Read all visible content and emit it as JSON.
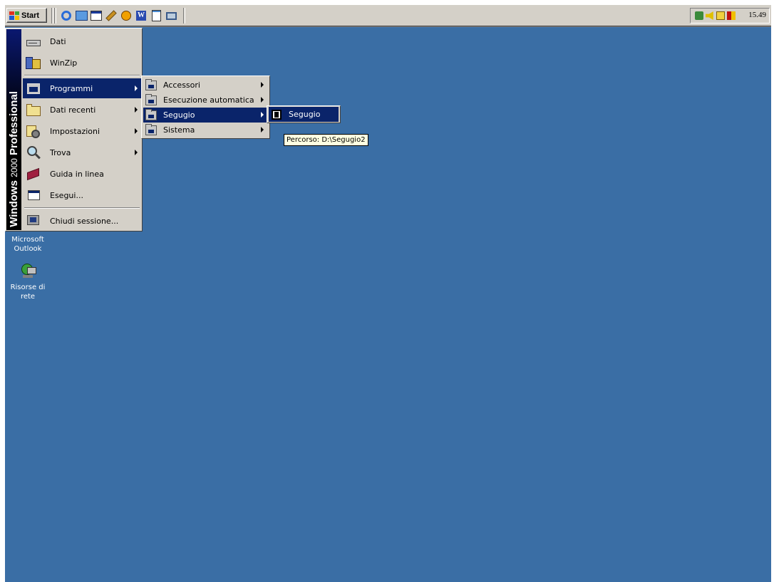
{
  "taskbar": {
    "start_label": "Start",
    "clock": "15.49",
    "quick_launch": [
      "ie-icon",
      "outlook-express-icon",
      "show-desktop-icon",
      "paint-icon",
      "media-player-icon",
      "word-icon",
      "notepad-icon",
      "computer-icon"
    ],
    "tray_icons": [
      "network-tray-icon",
      "volume-tray-icon",
      "printer-tray-icon",
      "antivirus-tray-icon"
    ]
  },
  "start_menu": {
    "banner_bold": "Windows",
    "banner_version": "2000",
    "banner_edition": "Professional",
    "items": [
      {
        "label": "Dati",
        "icon": "drive-icon"
      },
      {
        "label": "WinZip",
        "icon": "winzip-icon"
      },
      {
        "label": "Programmi",
        "icon": "programs-icon",
        "submenu": true,
        "active": true
      },
      {
        "label": "Dati recenti",
        "icon": "documents-folder-icon",
        "submenu": true
      },
      {
        "label": "Impostazioni",
        "icon": "settings-icon",
        "submenu": true
      },
      {
        "label": "Trova",
        "icon": "search-icon",
        "submenu": true
      },
      {
        "label": "Guida in linea",
        "icon": "help-book-icon"
      },
      {
        "label": "Esegui...",
        "icon": "run-icon"
      },
      {
        "label": "Chiudi sessione...",
        "icon": "shutdown-icon"
      }
    ]
  },
  "programs_menu": {
    "items": [
      {
        "label": "Accessori",
        "submenu": true
      },
      {
        "label": "Esecuzione automatica",
        "submenu": true
      },
      {
        "label": "Segugio",
        "submenu": true,
        "active": true
      },
      {
        "label": "Sistema",
        "submenu": true
      }
    ]
  },
  "segugio_menu": {
    "items": [
      {
        "label": "Segugio",
        "active": true
      }
    ]
  },
  "tooltip": "Percorso: D:\\Segugio2",
  "desktop": {
    "icons": [
      {
        "label_line1": "Microsoft",
        "label_line2": "Outlook"
      },
      {
        "label_line1": "Risorse di",
        "label_line2": "rete"
      }
    ]
  },
  "colors": {
    "desktop": "#3a6ea5",
    "highlight": "#0a246a",
    "face": "#d4d0c8",
    "tooltip": "#ffffe1"
  }
}
